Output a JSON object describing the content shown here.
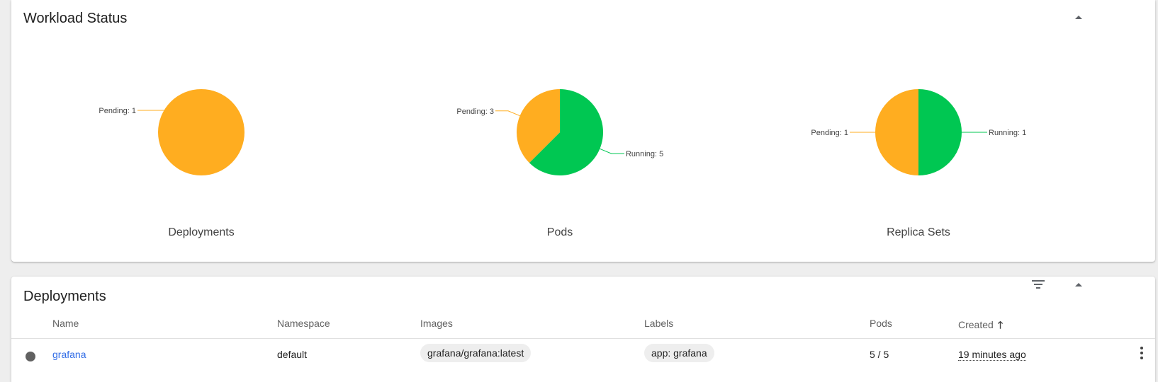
{
  "workload": {
    "title": "Workload Status",
    "charts": [
      {
        "name": "Deployments",
        "slices": [
          {
            "label": "Pending",
            "value": 1,
            "color": "#ffad20"
          }
        ]
      },
      {
        "name": "Pods",
        "slices": [
          {
            "label": "Running",
            "value": 5,
            "color": "#00c752"
          },
          {
            "label": "Pending",
            "value": 3,
            "color": "#ffad20"
          }
        ]
      },
      {
        "name": "Replica Sets",
        "slices": [
          {
            "label": "Running",
            "value": 1,
            "color": "#00c752"
          },
          {
            "label": "Pending",
            "value": 1,
            "color": "#ffad20"
          }
        ]
      }
    ]
  },
  "chart_data": [
    {
      "type": "pie",
      "title": "Deployments",
      "categories": [
        "Pending"
      ],
      "values": [
        1
      ]
    },
    {
      "type": "pie",
      "title": "Pods",
      "categories": [
        "Running",
        "Pending"
      ],
      "values": [
        5,
        3
      ]
    },
    {
      "type": "pie",
      "title": "Replica Sets",
      "categories": [
        "Running",
        "Pending"
      ],
      "values": [
        1,
        1
      ]
    }
  ],
  "deployments": {
    "title": "Deployments",
    "columns": {
      "name": "Name",
      "namespace": "Namespace",
      "images": "Images",
      "labels": "Labels",
      "pods": "Pods",
      "created": "Created",
      "sort_arrow": "🡑"
    },
    "rows": [
      {
        "status": "unknown",
        "name": "grafana",
        "namespace": "default",
        "image": "grafana/grafana:latest",
        "label": "app: grafana",
        "pods": "5 / 5",
        "created": "19 minutes ago"
      }
    ]
  },
  "colors": {
    "running": "#00c752",
    "pending": "#ffad20",
    "link": "#326de6"
  },
  "icons": [
    "arrow-drop-up-icon",
    "filter-list-icon",
    "more-vert-icon"
  ]
}
